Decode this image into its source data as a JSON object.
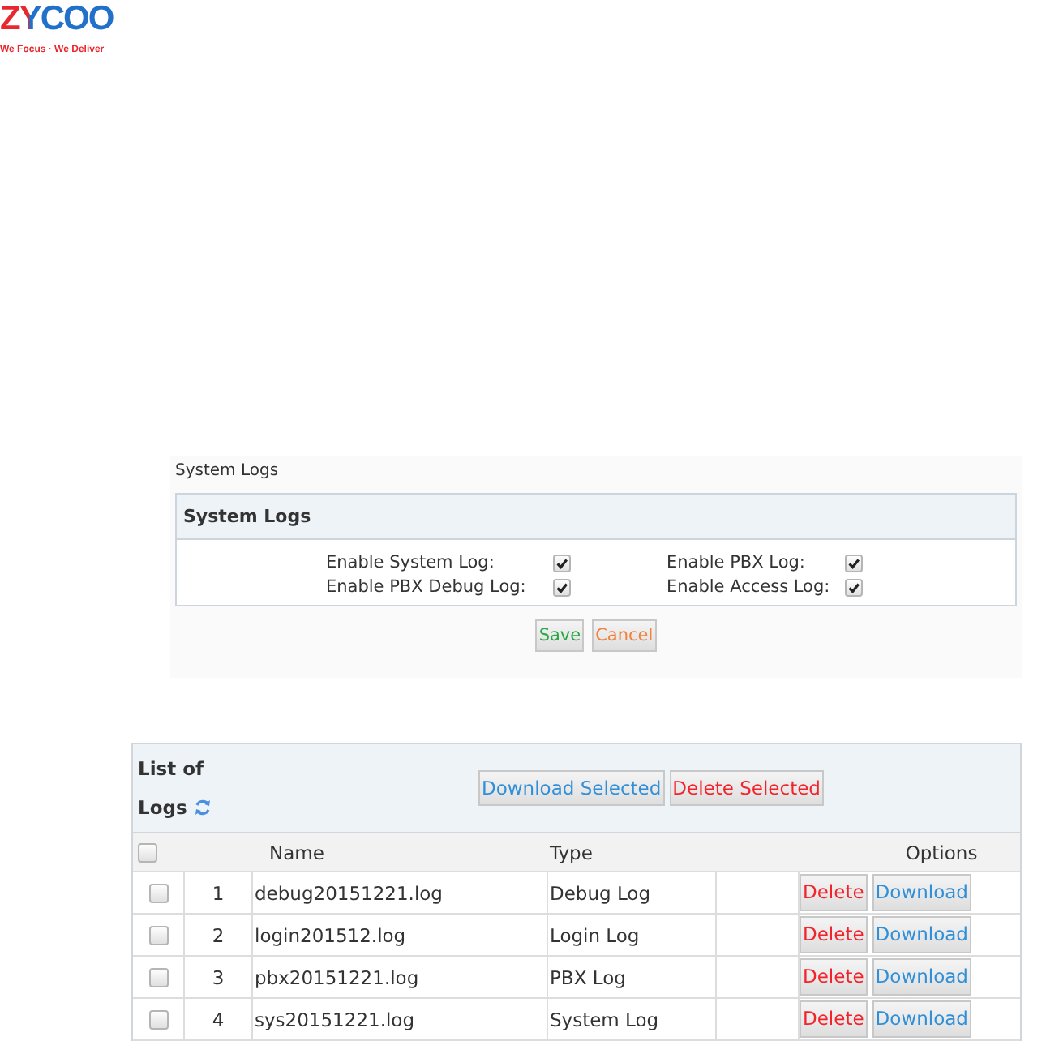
{
  "logo": {
    "wordmark": "ZYCOO",
    "tagline": "We Focus · We Deliver"
  },
  "settings": {
    "page_title": "System Logs",
    "panel_title": "System Logs",
    "options": [
      {
        "label": "Enable System Log:",
        "checked": true
      },
      {
        "label": "Enable PBX Log:",
        "checked": true
      },
      {
        "label": "Enable PBX Debug Log:",
        "checked": true
      },
      {
        "label": "Enable Access Log:",
        "checked": true
      }
    ],
    "buttons": [
      {
        "label": "Save",
        "kind": "save"
      },
      {
        "label": "Cancel",
        "kind": "cancel"
      }
    ]
  },
  "logs": {
    "title_line_1": "List of",
    "title_line_2": "Logs",
    "actions": [
      {
        "label": "Download Selected",
        "kind": "download"
      },
      {
        "label": "Delete Selected",
        "kind": "delete"
      }
    ],
    "select_all": {
      "checked": false
    },
    "columns": [
      "Name",
      "Type",
      "Options"
    ],
    "rows": [
      {
        "index": "1",
        "name": "debug20151221.log",
        "type": "Debug Log",
        "checked": false,
        "delete": "Delete",
        "download": "Download"
      },
      {
        "index": "2",
        "name": "login201512.log",
        "type": "Login Log",
        "checked": false,
        "delete": "Delete",
        "download": "Download"
      },
      {
        "index": "3",
        "name": "pbx20151221.log",
        "type": "PBX Log",
        "checked": false,
        "delete": "Delete",
        "download": "Download"
      },
      {
        "index": "4",
        "name": "sys20151221.log",
        "type": "System Log",
        "checked": false,
        "delete": "Delete",
        "download": "Download"
      }
    ]
  }
}
